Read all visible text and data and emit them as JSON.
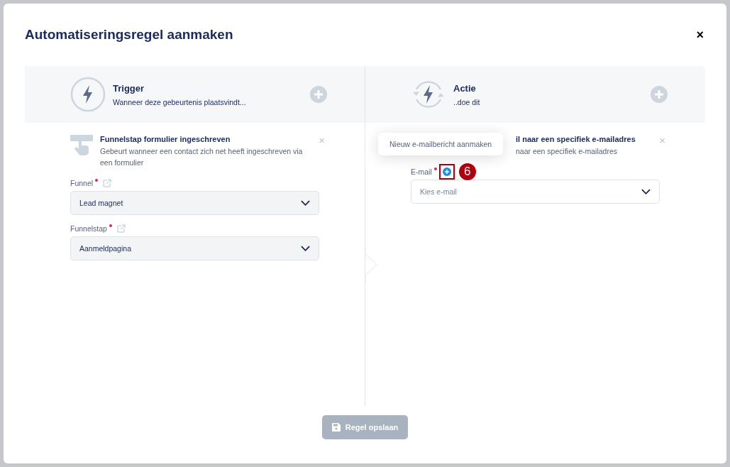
{
  "dialog": {
    "title": "Automatiseringsregel aanmaken",
    "close": "×"
  },
  "trigger": {
    "title": "Trigger",
    "subtitle": "Wanneer deze gebeurtenis plaatsvindt...",
    "card": {
      "title": "Funnelstap formulier ingeschreven",
      "description": "Gebeurt wanneer een contact zich net heeft ingeschreven via een formulier",
      "remove": "×"
    },
    "fields": [
      {
        "label": "Funnel",
        "required": true,
        "value": "Lead magnet"
      },
      {
        "label": "Funnelstap",
        "required": true,
        "value": "Aanmeldpagina"
      }
    ]
  },
  "action": {
    "title": "Actie",
    "subtitle": "..doe dit",
    "card": {
      "title_visible": "il naar een specifiek e-mailadres",
      "description_visible": "naar een specifiek e-mailadres",
      "remove": "×"
    },
    "fields": [
      {
        "label": "E-mail",
        "required": true,
        "placeholder": "Kies e-mail"
      }
    ],
    "tooltip": "Nieuw e-mailbericht aanmaken",
    "callout": "6"
  },
  "save_button": {
    "label": "Regel opslaan",
    "disabled": true
  }
}
